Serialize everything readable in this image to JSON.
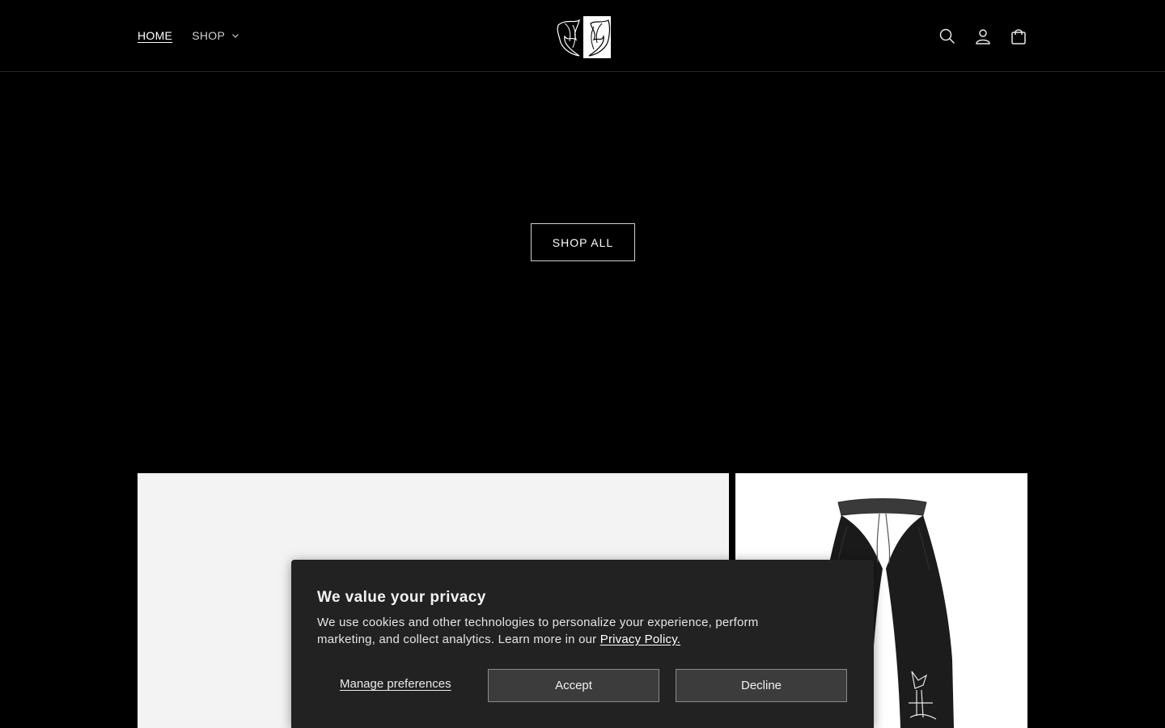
{
  "header": {
    "nav": {
      "home_label": "HOME",
      "shop_label": "SHOP"
    },
    "icons": [
      "search-icon",
      "account-icon",
      "cart-icon"
    ]
  },
  "hero": {
    "cta_label": "SHOP ALL"
  },
  "privacy": {
    "title": "We value your privacy",
    "description": "We use cookies and other technologies to personalize your experience, perform marketing, and collect analytics. Learn more in our ",
    "policy_link": "Privacy Policy.",
    "manage_label": "Manage preferences",
    "accept_label": "Accept",
    "decline_label": "Decline"
  },
  "colors": {
    "page_bg": "#000000",
    "card_bg": "#f3f3f3",
    "dialog_bg": "#222222",
    "button_bg": "#3c3c3c"
  }
}
